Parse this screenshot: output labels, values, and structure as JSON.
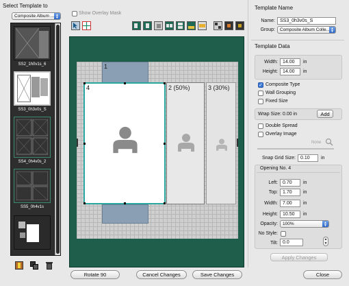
{
  "left_panel": {
    "title": "Select Template to",
    "dropdown_value": "Composite Album ...",
    "thumbnails": [
      {
        "label": "SS2_1h0v1s_6"
      },
      {
        "label": "SS3_0h3v0s_S"
      },
      {
        "label": "SS4_0h4v0s_2"
      },
      {
        "label": "SS5_0h4v1s"
      },
      {
        "label": ""
      }
    ]
  },
  "toolbar": {
    "show_overlay_mask_label": "Show Overlay Mask",
    "show_overlay_mask_checked": false
  },
  "canvas": {
    "background_color": "#1e5e4a",
    "openings": [
      {
        "number": "1"
      },
      {
        "number": "4"
      },
      {
        "number": "2 (50%)"
      },
      {
        "number": "3 (30%)"
      }
    ]
  },
  "template_name": {
    "section_title": "Template Name",
    "name_label": "Name:",
    "name_value": "SS3_0h3v0s_S",
    "group_label": "Group:",
    "group_value": "Composite Album Colle..."
  },
  "template_data": {
    "section_title": "Template Data",
    "width_label": "Width:",
    "width_value": "14.00",
    "height_label": "Height:",
    "height_value": "14.00",
    "unit": "in",
    "composite_type_label": "Composite Type",
    "composite_type_checked": true,
    "wall_grouping_label": "Wall Grouping",
    "wall_grouping_checked": false,
    "fixed_size_label": "Fixed Size",
    "fixed_size_checked": false,
    "wrap_size_label": "Wrap Size: 0.00 in",
    "add_button": "Add",
    "double_spread_label": "Double Spread",
    "double_spread_checked": false,
    "overlay_image_label": "Overlay Image",
    "overlay_image_checked": false,
    "none_label": "None",
    "snap_grid_label": "Snap Grid Size:",
    "snap_grid_value": "0.10"
  },
  "opening": {
    "title": "Opening No. 4",
    "left_label": "Left:",
    "left_value": "0.70",
    "top_label": "Top:",
    "top_value": "1.70",
    "width_label": "Width:",
    "width_value": "7.00",
    "height_label": "Height:",
    "height_value": "10.50",
    "opacity_label": "Opacity:",
    "opacity_value": "100%",
    "no_style_label": "No Style:",
    "no_style_checked": false,
    "tilt_label": "Tilt:",
    "tilt_value": "0.0",
    "apply_changes": "Apply Changes"
  },
  "bottom_buttons": {
    "rotate": "Rotate 90",
    "cancel": "Cancel Changes",
    "save": "Save Changes",
    "close": "Close"
  }
}
